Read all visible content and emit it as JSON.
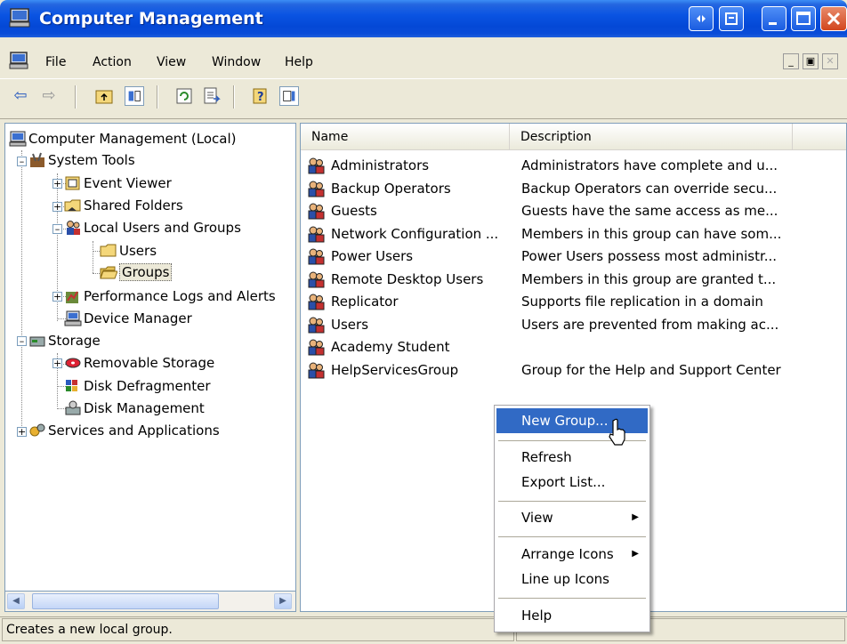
{
  "window": {
    "title": "Computer Management",
    "accent": "#0a54e2"
  },
  "menu": {
    "items": [
      "File",
      "Action",
      "View",
      "Window",
      "Help"
    ]
  },
  "toolbar": {
    "icons": [
      "back-icon",
      "forward-icon",
      "up-folder-icon",
      "show-hide-tree-icon",
      "refresh-icon",
      "export-list-icon",
      "help-icon",
      "show-hide-action-pane-icon"
    ]
  },
  "tree": {
    "root": "Computer Management (Local)",
    "system_tools": "System Tools",
    "event_viewer": "Event Viewer",
    "shared_folders": "Shared Folders",
    "local_users_groups": "Local Users and Groups",
    "users": "Users",
    "groups": "Groups",
    "perf_logs": "Performance Logs and Alerts",
    "device_manager": "Device Manager",
    "storage": "Storage",
    "removable_storage": "Removable Storage",
    "disk_defrag": "Disk Defragmenter",
    "disk_management": "Disk Management",
    "services_apps": "Services and Applications"
  },
  "list": {
    "columns": [
      "Name",
      "Description"
    ],
    "rows": [
      {
        "name": "Administrators",
        "description": "Administrators have complete and u..."
      },
      {
        "name": "Backup Operators",
        "description": "Backup Operators can override secu..."
      },
      {
        "name": "Guests",
        "description": "Guests have the same access as me..."
      },
      {
        "name": "Network Configuration ...",
        "description": "Members in this group can have som..."
      },
      {
        "name": "Power Users",
        "description": "Power Users possess most administr..."
      },
      {
        "name": "Remote Desktop Users",
        "description": "Members in this group are granted t..."
      },
      {
        "name": "Replicator",
        "description": "Supports file replication in a domain"
      },
      {
        "name": "Users",
        "description": "Users are prevented from making ac..."
      },
      {
        "name": "Academy Student",
        "description": ""
      },
      {
        "name": "HelpServicesGroup",
        "description": "Group for the Help and Support Center"
      }
    ]
  },
  "context_menu": {
    "new_group": "New Group...",
    "refresh": "Refresh",
    "export_list": "Export List...",
    "view": "View",
    "arrange_icons": "Arrange Icons",
    "line_up_icons": "Line up Icons",
    "help": "Help",
    "highlight_color": "#316ac5"
  },
  "status": {
    "text": "Creates a new local group."
  }
}
